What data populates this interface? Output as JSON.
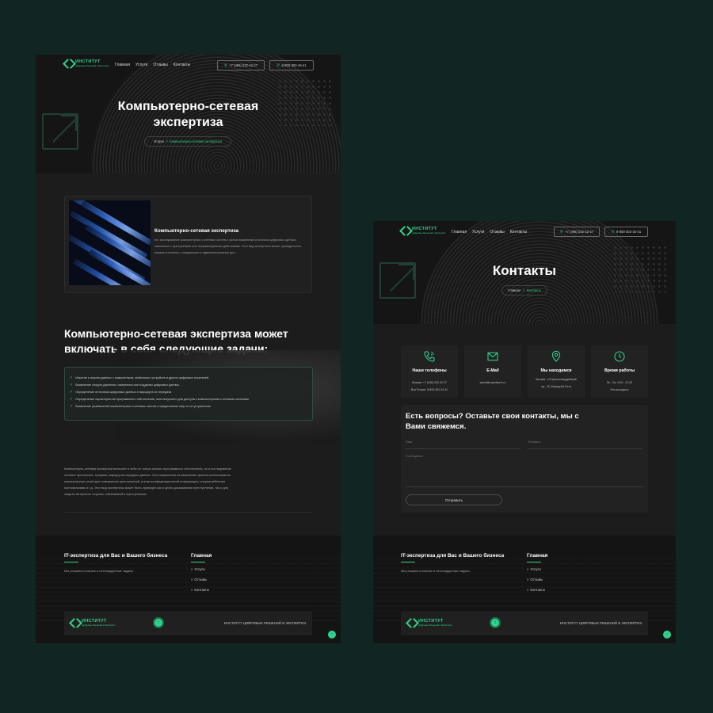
{
  "colors": {
    "background": "#112622",
    "panel": "#1c1c1c",
    "accent": "#2fd48c"
  },
  "brand": {
    "title": "ИНСТИТУТ",
    "subtitle": "цифровых Решений и Экспертиз"
  },
  "nav": {
    "items": [
      "Главная",
      "Услуги",
      "Отзывы",
      "Контакты"
    ]
  },
  "phones": {
    "main": "+7 (495) 032-42-27",
    "free": "8-800-302-34-41"
  },
  "page1": {
    "hero_title": "Компьютерно-сетевая экспертиза",
    "breadcrumb": {
      "parent": "Услуги",
      "current": "Компьютерно-сетевая экспертиза"
    },
    "card": {
      "title": "Компьютерно-сетевая экспертиза",
      "text": "это исследование компьютерных и сетевых систем с целью выявления и анализа цифровых данных, связанных с преступными или неправомерными действиями. Этот вид экспертизы может проводиться в рамках уголовных, гражданских и административных дел."
    },
    "tasks_heading": "Компьютерно-сетевая экспертиза может включать в себя следующие задачи:",
    "tasks": [
      "Изъятие и анализ данных с компьютеров, мобильных устройств и других цифровых носителей.",
      "Выявление следов удаления, изменения или подделки цифровых данных.",
      "Определение источника цифровых данных и маршрута их передачи.",
      "Определение характеристик программного обеспечения, используемого для доступа к компьютерным и сетевым системам.",
      "Выявление уязвимостей компьютерных и сетевых систем и предложение мер по их устранению."
    ],
    "paragraph": "Компьютерно-сетевая экспертиза включает в себя не только анализ программного обеспечения, но и исследование сетевых протоколов, трафика, маршрутов передачи данных. Она направлена на выявление фактов использования компьютерных сетей для совершения преступлений, утечки конфиденциальной информации, злоупотребления полномочиями и т.д. Этот вид экспертизы может быть проведен как в целях доказывания преступления, так и для защиты интересов стороны, обвиняемой в преступлении."
  },
  "page2": {
    "hero_title": "Контакты",
    "breadcrumb": {
      "parent": "Главная",
      "current": "Контакты"
    },
    "cards": [
      {
        "icon": "phone-icon",
        "title": "Наши телефоны",
        "lines": [
          "Москва: +7 (495) 032-42-27",
          "Вся Россия: 8-800-302-34-41"
        ]
      },
      {
        "icon": "mail-icon",
        "title": "E-Mail",
        "lines": [
          "sales@expertise-it.ru"
        ]
      },
      {
        "icon": "location-icon",
        "title": "Мы находимся",
        "lines": [
          "Москва, 1-й Красногвардейский",
          "пр., 15, Меркурий Сити"
        ]
      },
      {
        "icon": "clock-icon",
        "title": "Время работы",
        "lines": [
          "Пн - Вс: 9:00 - 21:00",
          "Без выходных"
        ]
      }
    ],
    "form": {
      "heading": "Есть вопросы? Оставьте свои контакты, мы с Вами свяжемся.",
      "name_placeholder": "Имя",
      "phone_placeholder": "Телефон",
      "message_placeholder": "Сообщение",
      "submit": "Отправить"
    }
  },
  "footer": {
    "heading": "IT-экспертиза для Вас и Вашего бизнеса",
    "text": "Мы решаем сложные и нестандартные задачи.",
    "links_heading": "Главная",
    "links": [
      "Услуги",
      "Отзывы",
      "Контакты"
    ],
    "brand": "ИНСТИТУТ ЦИФРОВЫХ РЕШЕНИЙ И ЭКСПЕРТИЗ",
    "up_icon": "arrow-up-icon"
  }
}
